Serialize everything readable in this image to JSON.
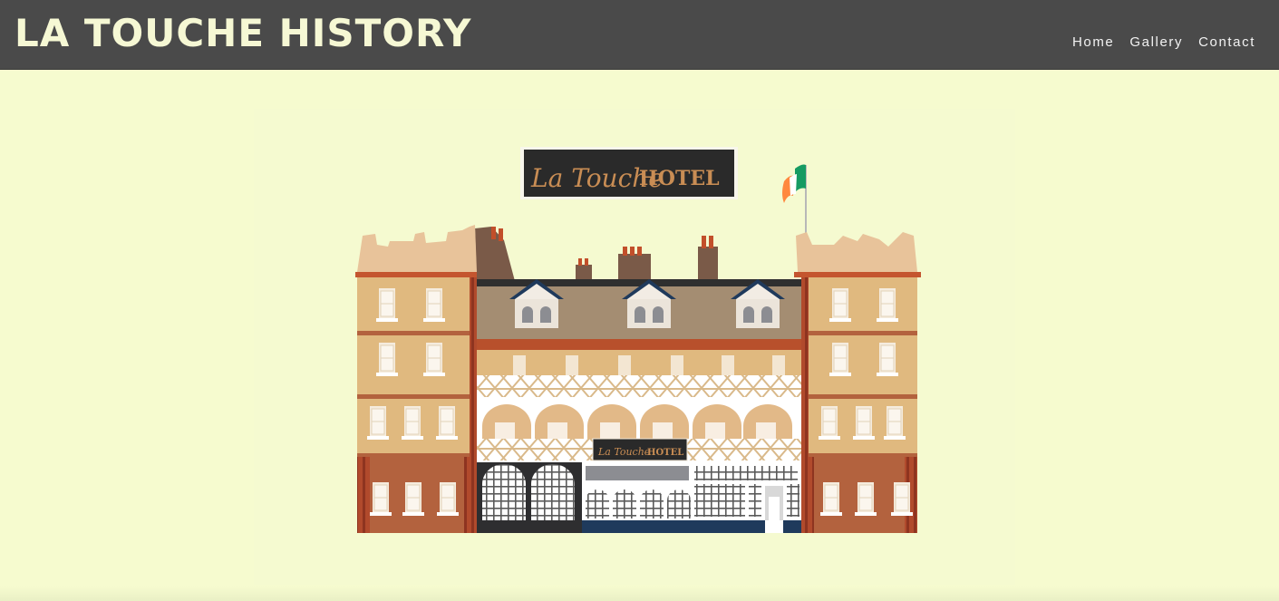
{
  "header": {
    "title": "LA TOUCHE HISTORY",
    "nav": [
      "Home",
      "Gallery",
      "Contact"
    ]
  },
  "hero": {
    "sign_script": "La Touche",
    "sign_word": "HOTEL",
    "small_sign_script": "La Touche",
    "small_sign_word": "HOTEL"
  },
  "colors": {
    "background": "#f6fbcf",
    "header": "#4a4a4a",
    "title": "#f6f8d4",
    "facade": "#e2bd84",
    "brick": "#b3623e",
    "flag_green": "#169b62",
    "flag_orange": "#ff883e"
  }
}
